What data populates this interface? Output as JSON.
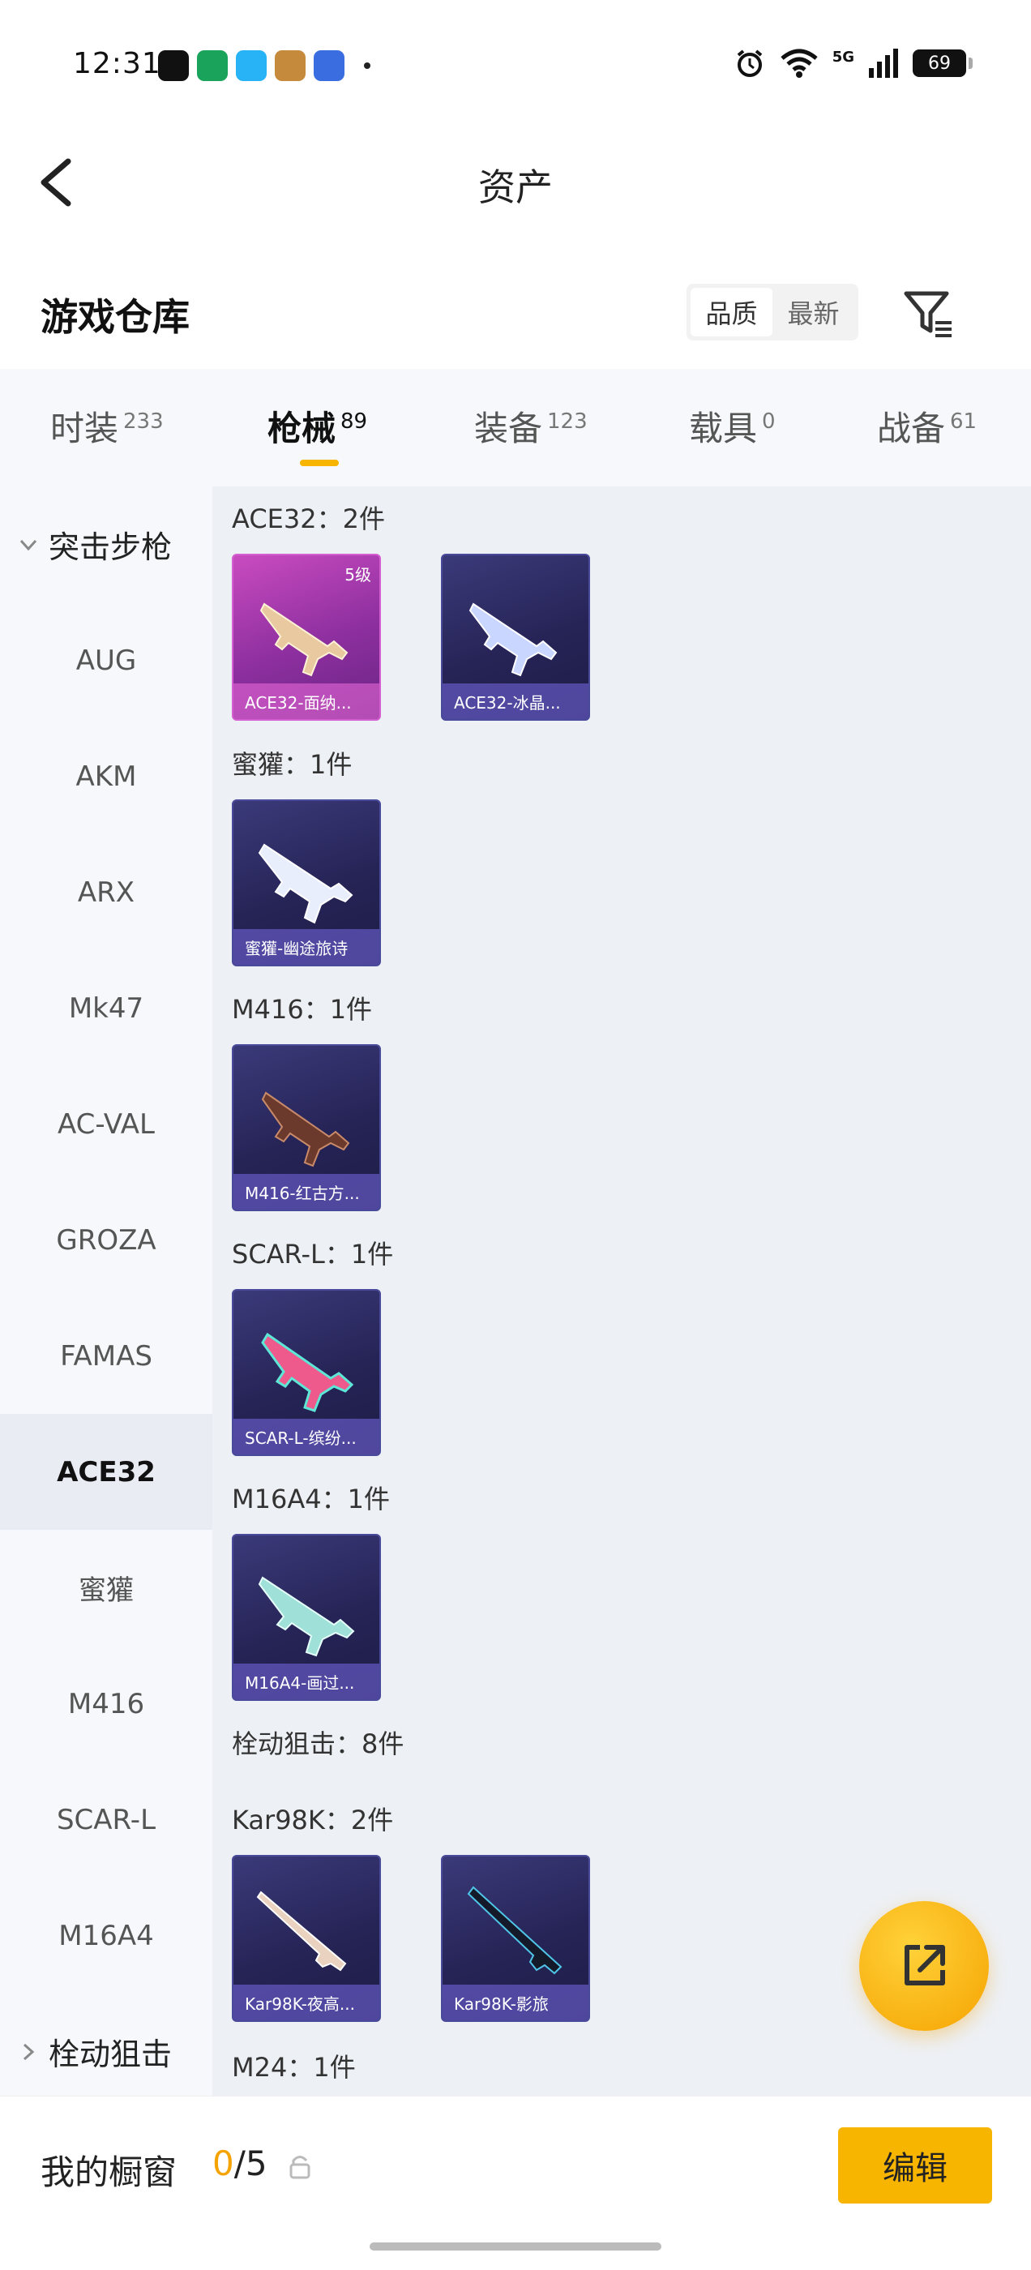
{
  "status_bar": {
    "time": "12:31",
    "network": "5G",
    "battery": "69",
    "app_icons": [
      "tiktok-icon",
      "oppo-store-icon",
      "video-app-icon",
      "game-icon-1",
      "game-icon-2"
    ]
  },
  "nav": {
    "title": "资产"
  },
  "warehouse": {
    "title": "游戏仓库",
    "sort_options": [
      "品质",
      "最新"
    ],
    "active_sort": "品质"
  },
  "tabs": [
    {
      "label": "时装",
      "count": "233"
    },
    {
      "label": "枪械",
      "count": "89",
      "active": true
    },
    {
      "label": "装备",
      "count": "123"
    },
    {
      "label": "载具",
      "count": "0"
    },
    {
      "label": "战备",
      "count": "61"
    }
  ],
  "sidebar": {
    "groups": {
      "assault": "突击步枪",
      "sniper": "栓动狙击"
    },
    "items": [
      "AUG",
      "AKM",
      "ARX",
      "Mk47",
      "AC-VAL",
      "GROZA",
      "FAMAS",
      "ACE32",
      "蜜獾",
      "M416",
      "SCAR-L",
      "M16A4"
    ],
    "active_item": "ACE32"
  },
  "content": {
    "groups": [
      {
        "label": "ACE32：2件",
        "cards": [
          {
            "name": "ACE32-面纳...",
            "level": "5级",
            "rarity": "legend"
          },
          {
            "name": "ACE32-冰晶...",
            "rarity": "epic"
          }
        ]
      },
      {
        "label": "蜜獾：1件",
        "cards": [
          {
            "name": "蜜獾-幽途旅诗",
            "rarity": "epic"
          }
        ]
      },
      {
        "label": "M416：1件",
        "cards": [
          {
            "name": "M416-红古方...",
            "rarity": "epic"
          }
        ]
      },
      {
        "label": "SCAR-L：1件",
        "cards": [
          {
            "name": "SCAR-L-缤纷...",
            "rarity": "epic"
          }
        ]
      },
      {
        "label": "M16A4：1件",
        "cards": [
          {
            "name": "M16A4-画过...",
            "rarity": "epic"
          }
        ]
      }
    ],
    "section_sniper": "栓动狙击：8件",
    "kar_group": {
      "label": "Kar98K：2件",
      "cards": [
        {
          "name": "Kar98K-夜高...",
          "rarity": "epic"
        },
        {
          "name": "Kar98K-影旅",
          "rarity": "epic"
        }
      ]
    },
    "m24_label": "M24：1件"
  },
  "bottom": {
    "showcase_label": "我的橱窗",
    "showcase_current": "0",
    "showcase_total": "/5",
    "edit_label": "编辑"
  },
  "colors": {
    "accent": "#f7b500",
    "legend_card": "#c94bc0",
    "epic_card": "#2c2a66"
  }
}
